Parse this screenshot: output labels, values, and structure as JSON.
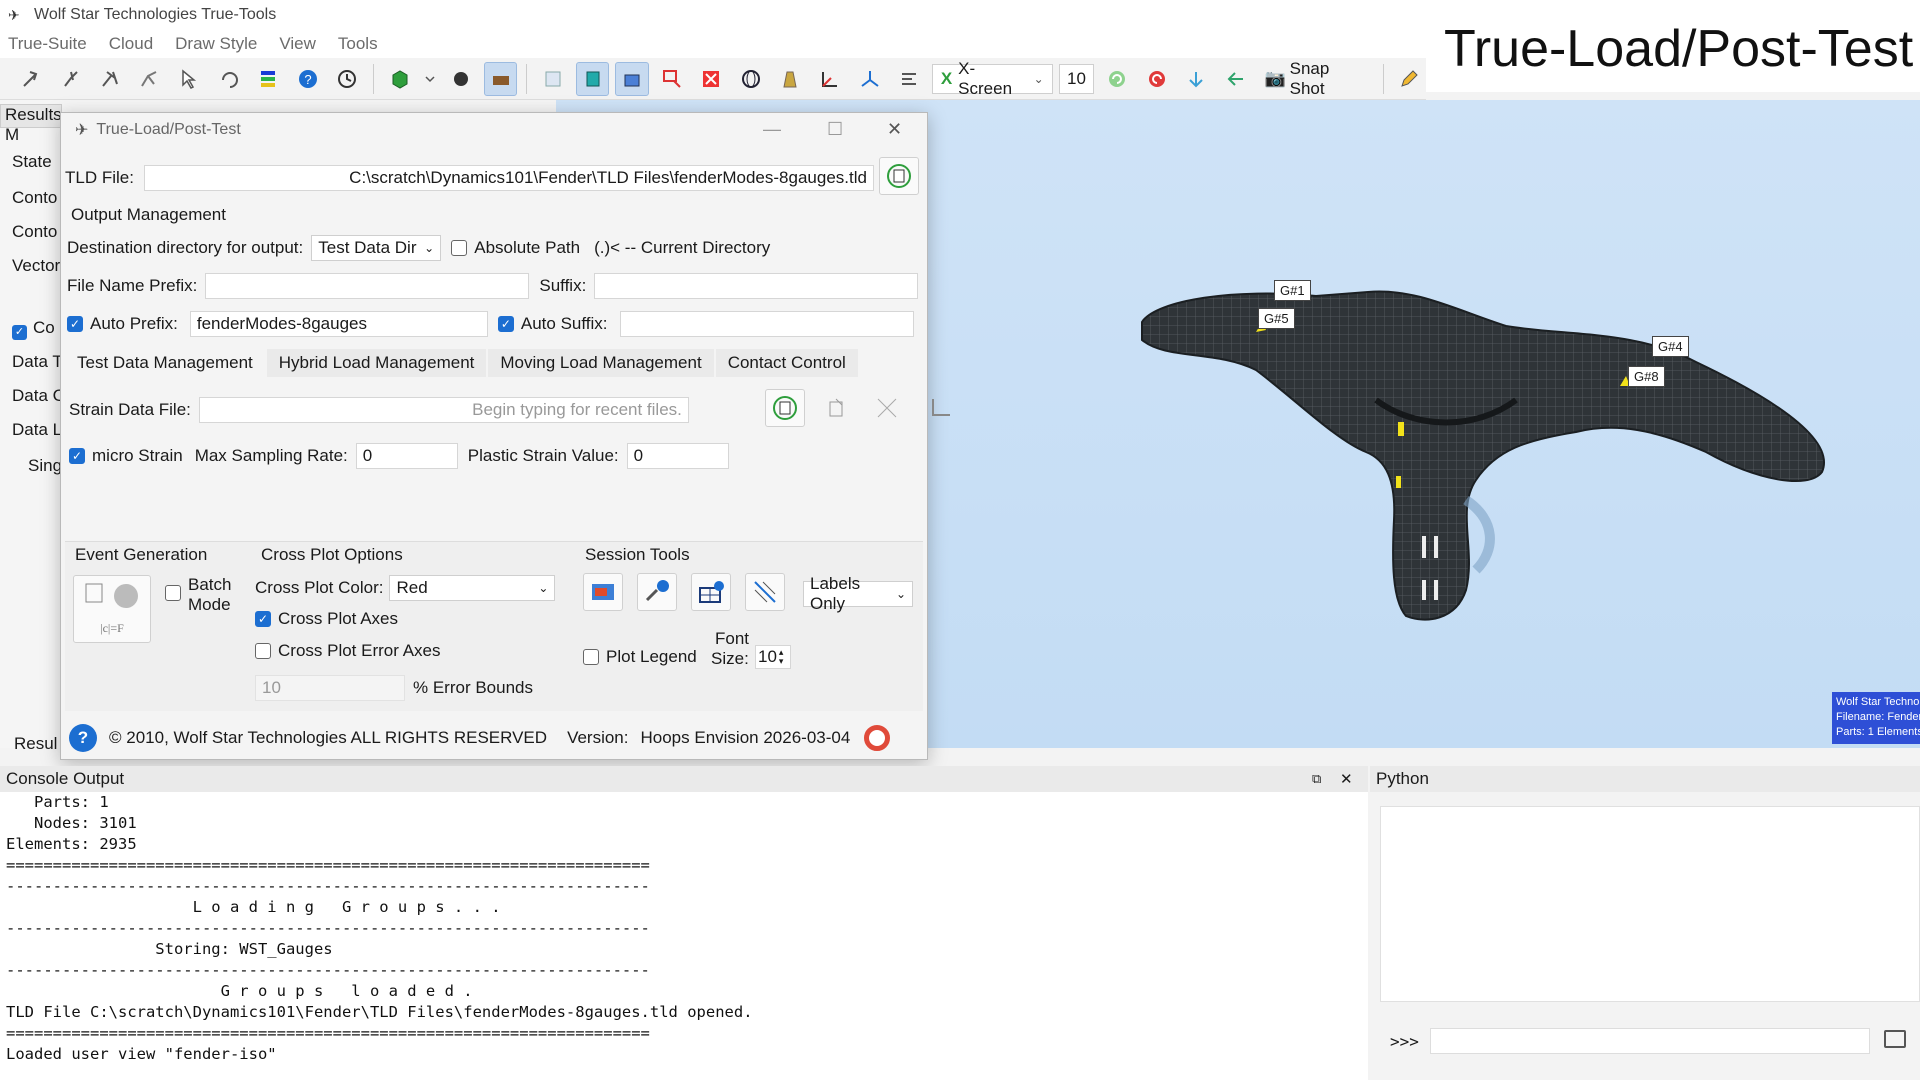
{
  "window": {
    "title": "Wolf Star Technologies True-Tools"
  },
  "menu": [
    "True-Suite",
    "Cloud",
    "Draw Style",
    "View",
    "Tools"
  ],
  "overlay_title": "True-Load/Post-Test",
  "toolbar": {
    "screen_combo": "X-Screen",
    "number_value": "10",
    "snapshot_label": "Snap Shot"
  },
  "results_panel": {
    "tab_label": "Results M",
    "items": [
      "State",
      "Conto",
      "Conto",
      "Vector",
      "Co",
      "Data T",
      "Data C",
      "Data L",
      "Sing"
    ],
    "bottom_tab": "Resul"
  },
  "viewport": {
    "gauges": [
      "G#1",
      "G#5",
      "G#4",
      "G#8"
    ],
    "info_box": [
      "Wolf Star Technologies",
      "Filename: Fender",
      "Parts: 1 Elements"
    ],
    "background": "#c9e0f6"
  },
  "dialog": {
    "title": "True-Load/Post-Test",
    "tld_label": "TLD File:",
    "tld_value": "C:\\scratch\\Dynamics101\\Fender\\TLD Files\\fenderModes-8gauges.tld",
    "output_mgmt_title": "Output Management",
    "dest_label": "Destination directory for output:",
    "dest_value": "Test Data Dir",
    "absolute_path_label": "Absolute Path",
    "current_dir_hint": "(.)< -- Current Directory",
    "prefix_label": "File Name Prefix:",
    "prefix_value": "",
    "suffix_label": "Suffix:",
    "suffix_value": "",
    "auto_prefix_label": "Auto Prefix:",
    "auto_prefix_value": "fenderModes-8gauges",
    "auto_suffix_label": "Auto Suffix:",
    "auto_suffix_value": "",
    "tabs": [
      "Test Data Management",
      "Hybrid Load Management",
      "Moving Load Management",
      "Contact Control"
    ],
    "strain_label": "Strain Data File:",
    "strain_placeholder": "Begin typing for recent files.",
    "micro_strain_label": "micro Strain",
    "max_sampling_label": "Max Sampling Rate:",
    "max_sampling_value": "0",
    "plastic_label": "Plastic Strain Value:",
    "plastic_value": "0",
    "event_gen_title": "Event Generation",
    "batch_mode_label_1": "Batch",
    "batch_mode_label_2": "Mode",
    "cross_plot_title": "Cross Plot Options",
    "cross_plot_color_label": "Cross Plot Color:",
    "cross_plot_color_value": "Red",
    "cross_plot_axes_label": "Cross Plot Axes",
    "cross_plot_error_label": "Cross Plot Error Axes",
    "error_bounds_value": "10",
    "error_bounds_label": "% Error Bounds",
    "session_tools_title": "Session Tools",
    "labels_only_value": "Labels Only",
    "plot_legend_label": "Plot Legend",
    "font_size_label_1": "Font",
    "font_size_label_2": "Size:",
    "font_size_value": "10",
    "copyright": "© 2010, Wolf Star Technologies  ALL RIGHTS RESERVED",
    "version_label": "Version:",
    "version_value": "Hoops Envision 2026-03-04"
  },
  "console": {
    "title": "Console Output",
    "lines": [
      "   Parts: 1",
      "   Nodes: 3101",
      "Elements: 2935",
      "=====================================================================",
      "---------------------------------------------------------------------",
      "                    L o a d i n g   G r o u p s . . .",
      "---------------------------------------------------------------------",
      "                Storing: WST_Gauges",
      "---------------------------------------------------------------------",
      "                       G r o u p s   l o a d e d .",
      "TLD File C:\\scratch\\Dynamics101\\Fender\\TLD Files\\fenderModes-8gauges.tld opened.",
      "=====================================================================",
      "Loaded user view \"fender-iso\""
    ]
  },
  "python": {
    "title": "Python",
    "prompt": ">>>"
  },
  "colors": {
    "accent": "#1c6ed1",
    "viewport": "#c9e0f6",
    "mesh": "#2b3034",
    "gauge": "#f2e21a"
  }
}
